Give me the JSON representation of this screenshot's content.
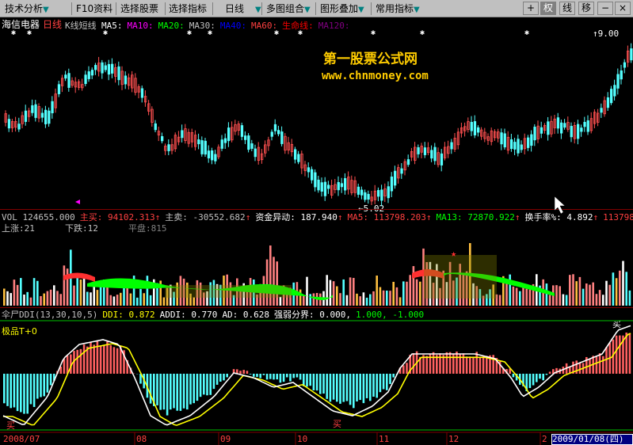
{
  "toolbar": {
    "items": [
      "技术分析",
      "F10资料",
      "选择股票",
      "选择指标",
      "日线",
      "多图组合",
      "图形叠加",
      "常用指标"
    ],
    "right_buttons": [
      "+",
      "权",
      "线",
      "移",
      "−",
      "×"
    ],
    "active_right": "权"
  },
  "main_panel": {
    "stock_name": "海信电器",
    "period": "日线",
    "style": "K线短线",
    "ma_labels": [
      {
        "text": "MA5:",
        "color": "#ffffff"
      },
      {
        "text": "MA10:",
        "color": "#ff00ff"
      },
      {
        "text": "MA20:",
        "color": "#00ff00"
      },
      {
        "text": "MA30:",
        "color": "#c0c0c0"
      },
      {
        "text": "MA40:",
        "color": "#0000ff"
      },
      {
        "text": "MA60:",
        "color": "#ff4040"
      },
      {
        "text": "生命线:",
        "color": "#ff0000"
      },
      {
        "text": "MA120:",
        "color": "#800080"
      }
    ],
    "high_label": "9.00",
    "low_label": "5.02",
    "brand_title": "第一股票公式网",
    "brand_url": "www.chnmoney.com"
  },
  "vol_panel": {
    "header": [
      {
        "text": "VOL 124655.000",
        "color": "#c0c0c0"
      },
      {
        "text": "主买: 94102.313",
        "color": "#ff4040"
      },
      {
        "text": "主卖: -30552.682",
        "color": "#c0c0c0"
      },
      {
        "text": "资金异动: 187.940",
        "color": "#ffffff"
      },
      {
        "text": "MA5: 113798.203",
        "color": "#ff4040"
      },
      {
        "text": "MA13: 72870.922",
        "color": "#00ff00"
      },
      {
        "text": "换手率%: 4.892",
        "color": "#ffffff"
      },
      {
        "text": "113798",
        "color": "#ff4040"
      }
    ],
    "up_label": "上涨:21",
    "down_label": "下跌:12",
    "flat_label": "平盘:815"
  },
  "ddi_panel": {
    "header": [
      {
        "text": "伞尸DDI(13,30,10,5)",
        "color": "#c0c0c0"
      },
      {
        "text": "DDI: 0.872",
        "color": "#ffff00"
      },
      {
        "text": "ADDI: 0.770",
        "color": "#ffffff"
      },
      {
        "text": "AD: 0.628",
        "color": "#ffffff"
      },
      {
        "text": "强弱分界: 0.000,",
        "color": "#ffffff"
      },
      {
        "text": "1.000, -1.000",
        "color": "#00ff00"
      }
    ],
    "sub_label": "极品T+0",
    "buy_label_1": "买",
    "buy_label_2": "买",
    "buy_label_3": "买"
  },
  "date_axis": {
    "labels": [
      "2008/07",
      "08",
      "09",
      "10",
      "11",
      "12",
      "2"
    ],
    "current_date": "2009/01/08(四)"
  }
}
